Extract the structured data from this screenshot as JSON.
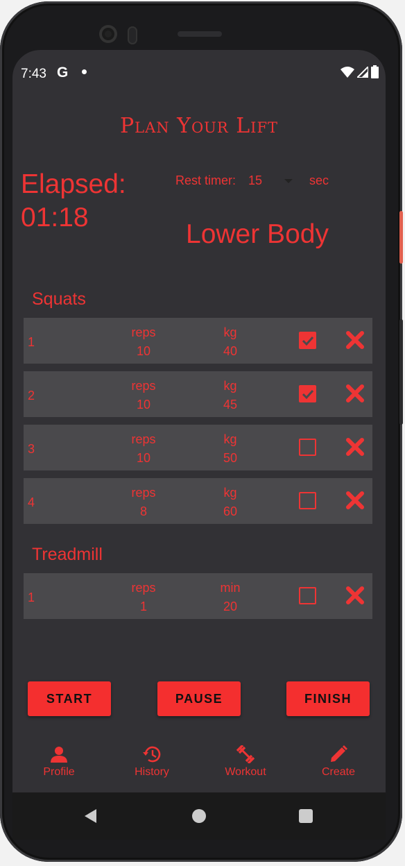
{
  "status_bar": {
    "time": "7:43",
    "g_label": "G"
  },
  "app": {
    "title": "Plan Your Lift"
  },
  "elapsed": {
    "label": "Elapsed:",
    "value": "01:18"
  },
  "rest_timer": {
    "label": "Rest timer:",
    "value": "15",
    "unit": "sec"
  },
  "workout": {
    "name": "Lower Body"
  },
  "exercises": [
    {
      "name": "Squats",
      "sets": [
        {
          "number": "1",
          "reps_label": "reps",
          "reps": "10",
          "unit_label": "kg",
          "unit_value": "40",
          "done": true
        },
        {
          "number": "2",
          "reps_label": "reps",
          "reps": "10",
          "unit_label": "kg",
          "unit_value": "45",
          "done": true
        },
        {
          "number": "3",
          "reps_label": "reps",
          "reps": "10",
          "unit_label": "kg",
          "unit_value": "50",
          "done": false
        },
        {
          "number": "4",
          "reps_label": "reps",
          "reps": "8",
          "unit_label": "kg",
          "unit_value": "60",
          "done": false
        }
      ]
    },
    {
      "name": "Treadmill",
      "sets": [
        {
          "number": "1",
          "reps_label": "reps",
          "reps": "1",
          "unit_label": "min",
          "unit_value": "20",
          "done": false
        }
      ]
    }
  ],
  "buttons": {
    "start": "START",
    "pause": "PAUSE",
    "finish": "FINISH"
  },
  "nav": [
    {
      "label": "Profile",
      "icon": "person-icon"
    },
    {
      "label": "History",
      "icon": "history-icon"
    },
    {
      "label": "Workout",
      "icon": "dumbbell-icon"
    },
    {
      "label": "Create",
      "icon": "pencil-icon"
    }
  ],
  "colors": {
    "accent": "#ee3434",
    "button": "#f42f2f",
    "background": "#323135",
    "row": "#4a494c"
  }
}
